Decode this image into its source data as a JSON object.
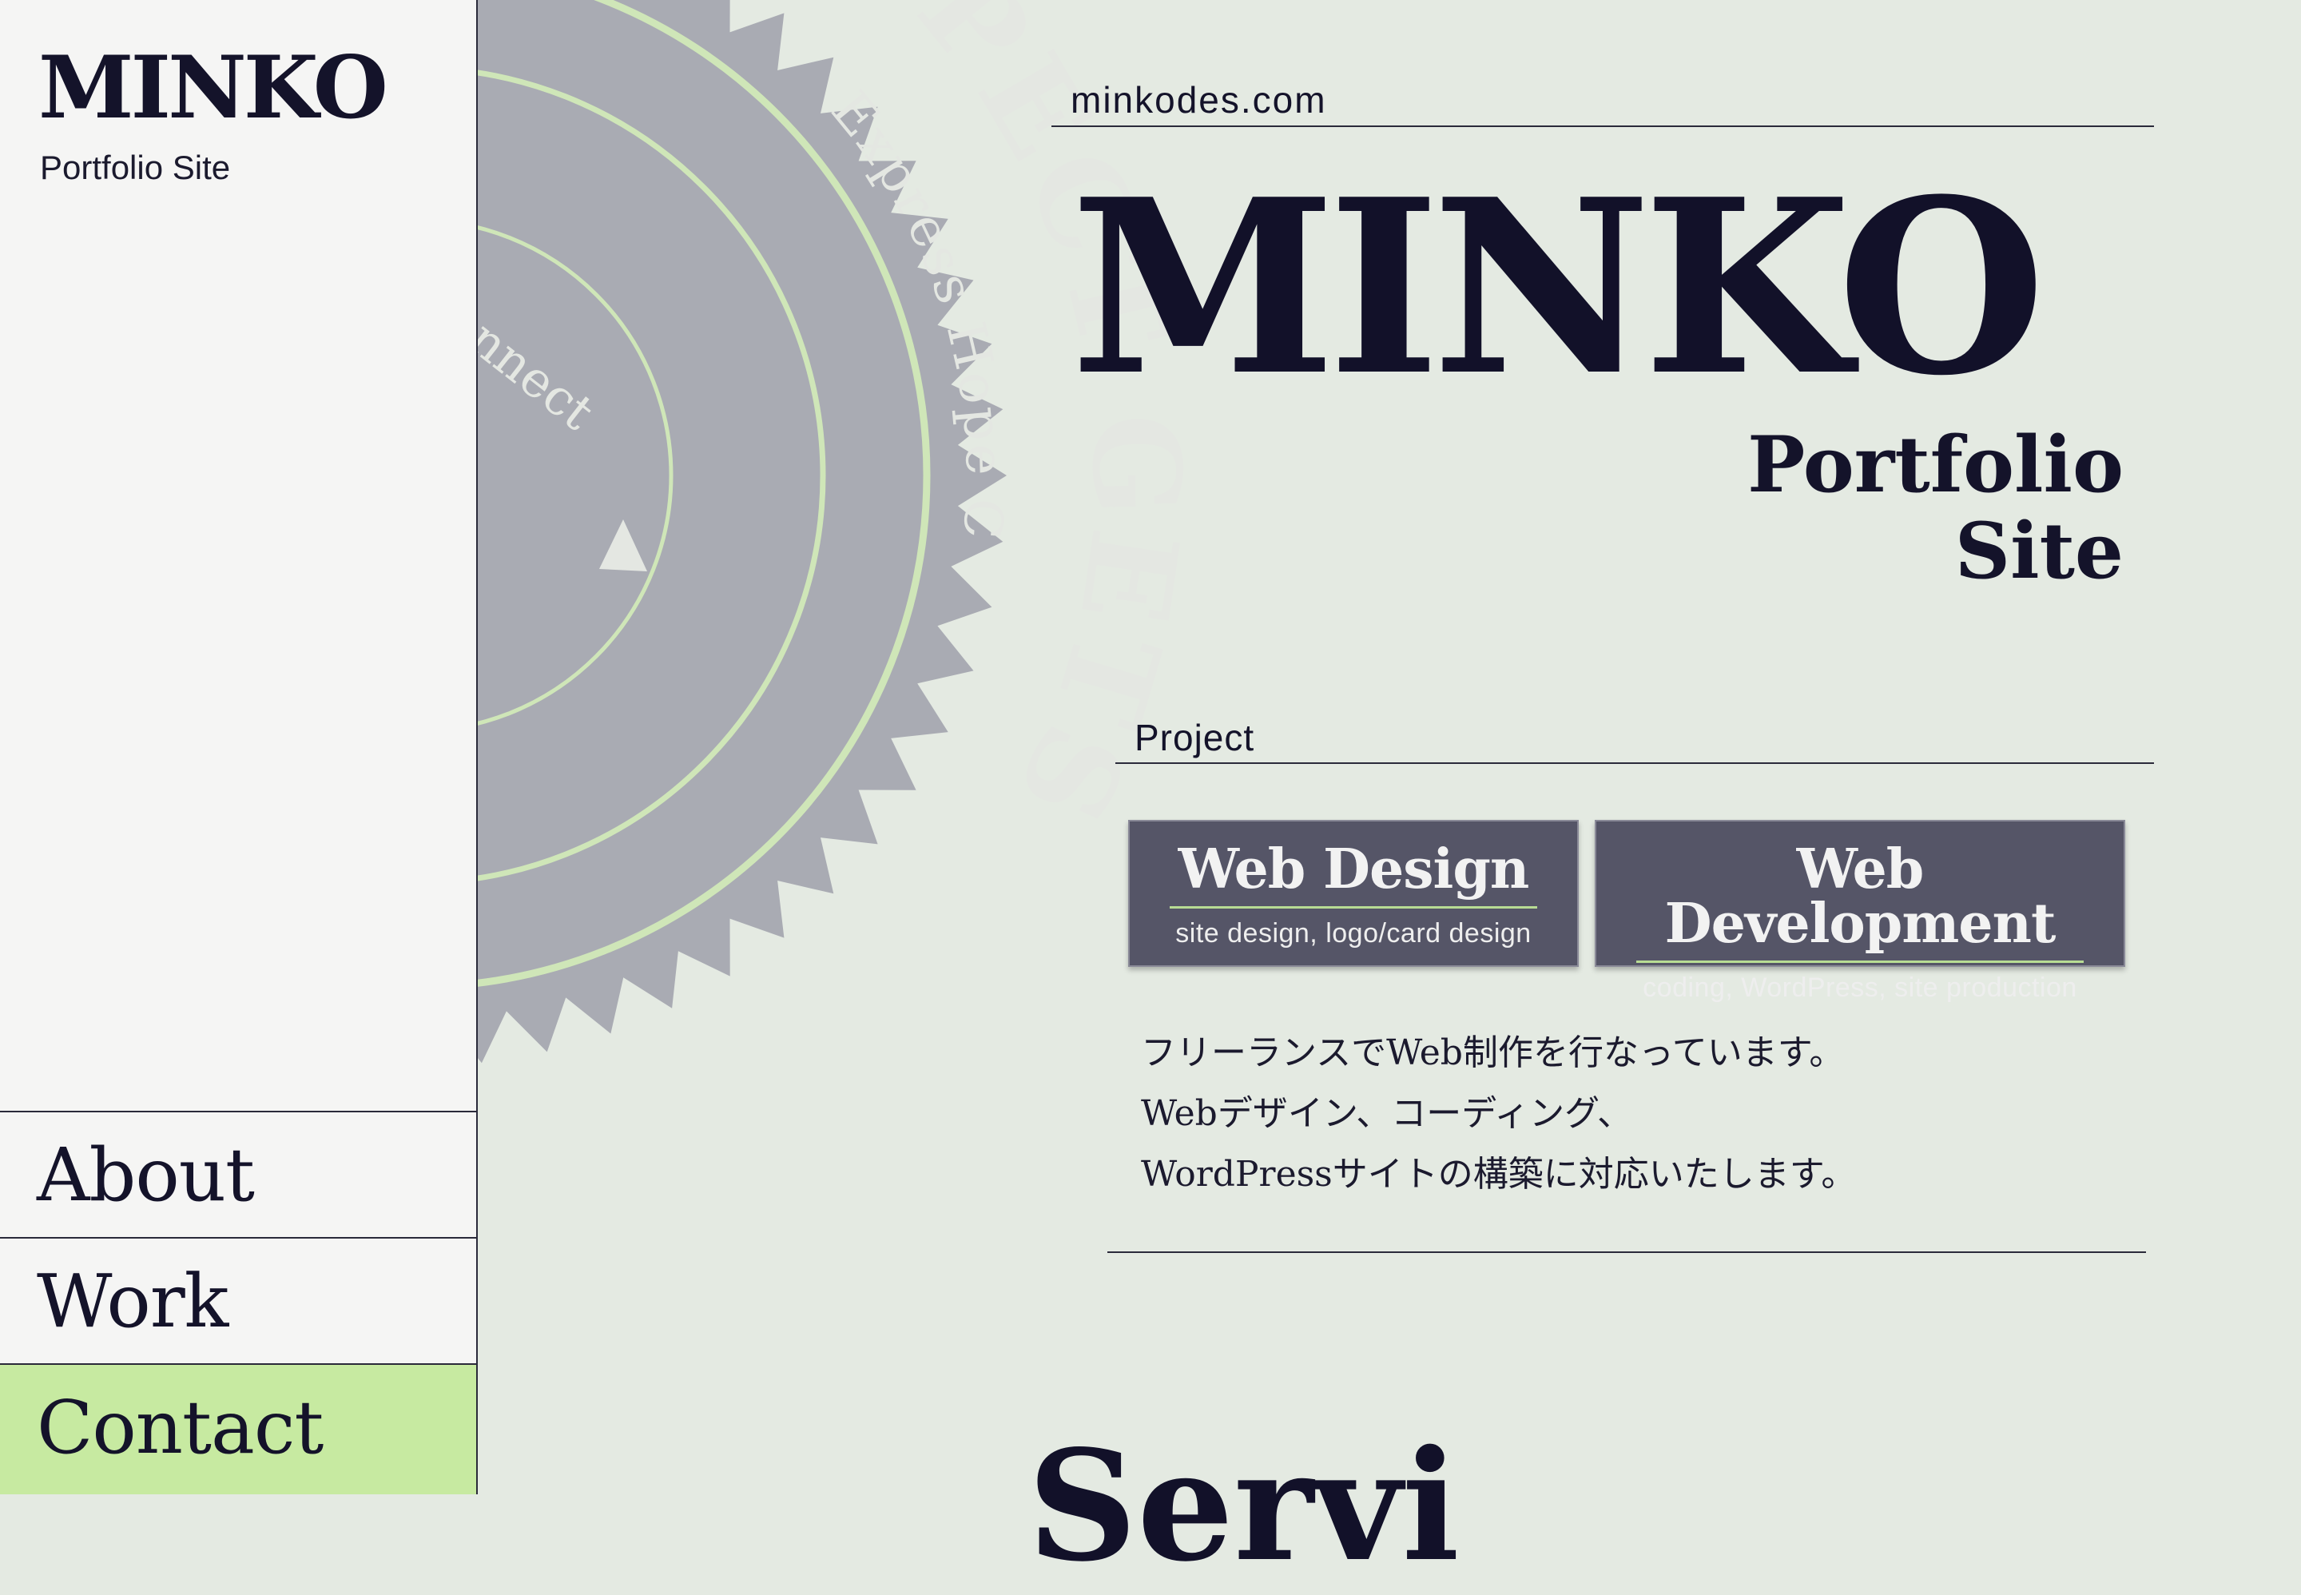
{
  "sidebar": {
    "logo": "MINKO",
    "subtitle": "Portfolio Site",
    "nav": [
      {
        "label": "About"
      },
      {
        "label": "Work"
      },
      {
        "label": "Contact",
        "active": true
      }
    ]
  },
  "seal": {
    "outer_text": "RESPECT GETS",
    "inner_text": "Express Hope C",
    "partial_text": "nnect"
  },
  "main": {
    "domain": "minkodes.com",
    "hero_title": "MINKO",
    "hero_sub_line1": "Portfolio",
    "hero_sub_line2": "Site",
    "project_label": "Project",
    "services": [
      {
        "title": "Web Design",
        "desc": "site design, logo/card design"
      },
      {
        "title": "Web Development",
        "desc": "coding, WordPress, site production"
      }
    ],
    "intro": [
      "フリーランスでWeb制作を行なっています。",
      "Webデザイン、コーディング、",
      "WordPressサイトの構築に対応いたします。"
    ],
    "next_heading_peek": "Servi"
  },
  "colors": {
    "background": "#e4eae2",
    "sidebar": "#f5f5f4",
    "navy": "#14132a",
    "accent_green": "#c7eaa1",
    "card": "#555567",
    "seal": "#a9abb3"
  }
}
